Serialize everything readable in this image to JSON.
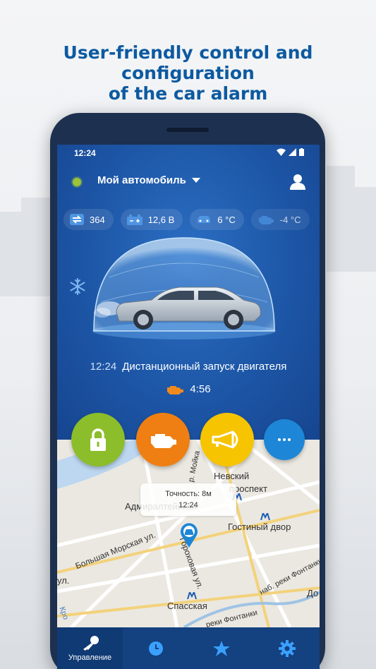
{
  "headline": {
    "line1": "User-friendly control and configuration",
    "line2": "of the car alarm"
  },
  "status_bar": {
    "time": "12:24"
  },
  "app_bar": {
    "car_name": "Мой автомобиль",
    "online_color": "#9cc43a"
  },
  "sensors": [
    {
      "icon": "mileage-icon",
      "value": "364"
    },
    {
      "icon": "battery-icon",
      "value": "12,6 В"
    },
    {
      "icon": "car-temperature-icon",
      "value": "6 °C"
    },
    {
      "icon": "engine-temperature-icon",
      "value": "-4 °C"
    }
  ],
  "event": {
    "time": "12:24",
    "text": "Дистанционный запуск двигателя",
    "remaining": "4:56"
  },
  "map": {
    "accuracy": "Точность: 8м",
    "accuracy_time": "12:24",
    "labels": {
      "nevsky": "Невский",
      "prospekt": "проспект",
      "admiralty": "Адмиралтейская",
      "gostiny": "Гостиный двор",
      "bolshaya_morskaya": "Большая Морская ул.",
      "gorokhovaya": "Гороховая ул.",
      "sennaya": "Спасская",
      "fontanka": "наб. реки Фонтанки",
      "fontanka2": "реки Фонтанки",
      "moika": "р. Мойка",
      "ulitsa": "ул.",
      "do": "До",
      "kro": "Кро"
    }
  },
  "actions": [
    {
      "name": "lock",
      "color": "#8cbd2b"
    },
    {
      "name": "engine-start",
      "color": "#ef7f12"
    },
    {
      "name": "horn",
      "color": "#f6c400"
    },
    {
      "name": "more",
      "color": "#1e86d6"
    }
  ],
  "bottom_nav": {
    "control_label": "Управление"
  },
  "colors": {
    "brand_blue": "#0d5aa0",
    "nav_bg": "#14417f",
    "engine_icon": "#f08a1c"
  }
}
